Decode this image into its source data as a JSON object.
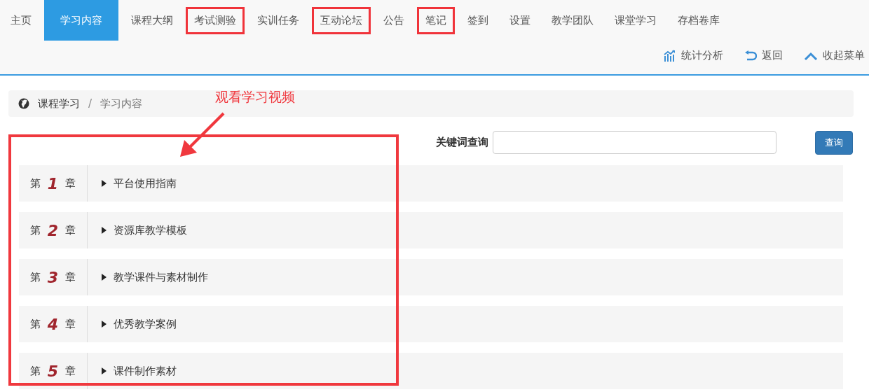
{
  "nav": {
    "tabs": [
      {
        "label": "主页",
        "selected": false,
        "highlighted": false
      },
      {
        "label": "学习内容",
        "selected": true,
        "highlighted": false
      },
      {
        "label": "课程大纲",
        "selected": false,
        "highlighted": false
      },
      {
        "label": "考试测验",
        "selected": false,
        "highlighted": true
      },
      {
        "label": "实训任务",
        "selected": false,
        "highlighted": false
      },
      {
        "label": "互动论坛",
        "selected": false,
        "highlighted": true
      },
      {
        "label": "公告",
        "selected": false,
        "highlighted": false
      },
      {
        "label": "笔记",
        "selected": false,
        "highlighted": true
      },
      {
        "label": "签到",
        "selected": false,
        "highlighted": false
      },
      {
        "label": "设置",
        "selected": false,
        "highlighted": false
      },
      {
        "label": "教学团队",
        "selected": false,
        "highlighted": false
      },
      {
        "label": "课堂学习",
        "selected": false,
        "highlighted": false
      },
      {
        "label": "存档卷库",
        "selected": false,
        "highlighted": false
      }
    ],
    "actions": [
      {
        "label": "统计分析",
        "kind": "chart"
      },
      {
        "label": "返回",
        "kind": "back"
      },
      {
        "label": "收起菜单",
        "kind": "collapse"
      }
    ]
  },
  "breadcrumb": [
    "课程学习",
    "学习内容"
  ],
  "breadcrumb_separator": "/",
  "annotation": {
    "text": "观看学习视频"
  },
  "search": {
    "label": "关键词查询",
    "button": "查询"
  },
  "chapter_list": {
    "highlighted": true,
    "chapters": [
      {
        "prefix": "第",
        "number": "1",
        "suffix": "章",
        "title": "平台使用指南"
      },
      {
        "prefix": "第",
        "number": "2",
        "suffix": "章",
        "title": "资源库教学模板"
      },
      {
        "prefix": "第",
        "number": "3",
        "suffix": "章",
        "title": "教学课件与素材制作"
      },
      {
        "prefix": "第",
        "number": "4",
        "suffix": "章",
        "title": "优秀教学案例"
      },
      {
        "prefix": "第",
        "number": "5",
        "suffix": "章",
        "title": "课件制作素材"
      }
    ]
  }
}
